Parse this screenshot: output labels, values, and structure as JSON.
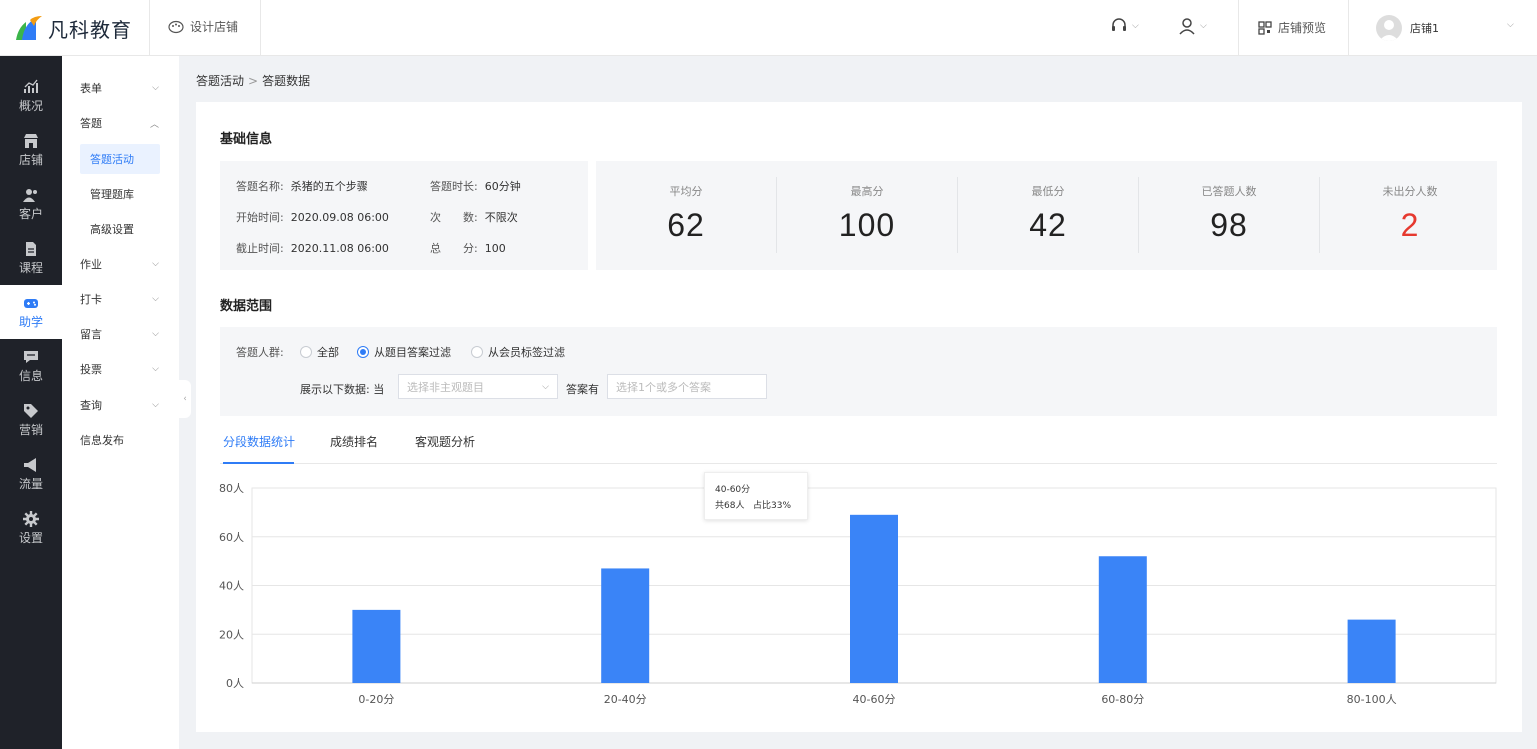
{
  "header": {
    "logo_text": "凡科教育",
    "design_store": "设计店铺",
    "store_preview": "店铺预览",
    "user_name": "店铺1"
  },
  "rail": [
    {
      "label": "概况",
      "icon": "chart-icon"
    },
    {
      "label": "店铺",
      "icon": "store-icon"
    },
    {
      "label": "客户",
      "icon": "customer-icon"
    },
    {
      "label": "课程",
      "icon": "course-icon"
    },
    {
      "label": "助学",
      "icon": "gamepad-icon",
      "active": true
    },
    {
      "label": "信息",
      "icon": "message-icon"
    },
    {
      "label": "营销",
      "icon": "tag-icon"
    },
    {
      "label": "流量",
      "icon": "megaphone-icon"
    },
    {
      "label": "设置",
      "icon": "gear-icon"
    }
  ],
  "submenu": {
    "form": "表单",
    "quiz": "答题",
    "quiz_activity": "答题活动",
    "manage_bank": "管理题库",
    "advanced": "高级设置",
    "homework": "作业",
    "checkin": "打卡",
    "message": "留言",
    "vote": "投票",
    "query": "查询",
    "publish": "信息发布"
  },
  "breadcrumb": {
    "parent": "答题活动",
    "sep": ">",
    "current": "答题数据"
  },
  "basic": {
    "title": "基础信息",
    "name_label": "答题名称:",
    "name_value": "杀猪的五个步骤",
    "duration_label": "答题时长:",
    "duration_value": "60分钟",
    "start_label": "开始时间:",
    "start_value": "2020.09.08 06:00",
    "times_label": "次　　数:",
    "times_value": "不限次",
    "end_label": "截止时间:",
    "end_value": "2020.11.08 06:00",
    "total_label": "总　　分:",
    "total_value": "100"
  },
  "stats": [
    {
      "label": "平均分",
      "value": "62"
    },
    {
      "label": "最高分",
      "value": "100"
    },
    {
      "label": "最低分",
      "value": "42"
    },
    {
      "label": "已答题人数",
      "value": "98"
    },
    {
      "label": "未出分人数",
      "value": "2",
      "highlight": true
    }
  ],
  "range": {
    "title": "数据范围",
    "crowd_label": "答题人群:",
    "opt_all": "全部",
    "opt_answer": "从题目答案过滤",
    "opt_member": "从会员标签过滤",
    "show_label": "展示以下数据:",
    "when": "当",
    "question_placeholder": "选择非主观题目",
    "answer_has": "答案有",
    "answer_placeholder": "选择1个或多个答案"
  },
  "tabs": [
    "分段数据统计",
    "成绩排名",
    "客观题分析"
  ],
  "colors": {
    "accent": "#2f7cf6",
    "bar": "#3a84f7",
    "red": "#e6392f",
    "rail": "#1f2229"
  },
  "chart_data": {
    "type": "bar",
    "categories": [
      "0-20分",
      "20-40分",
      "40-60分",
      "60-80分",
      "80-100人"
    ],
    "values": [
      30,
      47,
      69,
      52,
      26
    ],
    "y_ticks": [
      "0人",
      "20人",
      "40人",
      "60人",
      "80人"
    ],
    "ylim": [
      0,
      80
    ],
    "grid": true,
    "tooltip": {
      "title": "40-60分",
      "count": "共68人",
      "ratio": "占比33%"
    }
  }
}
